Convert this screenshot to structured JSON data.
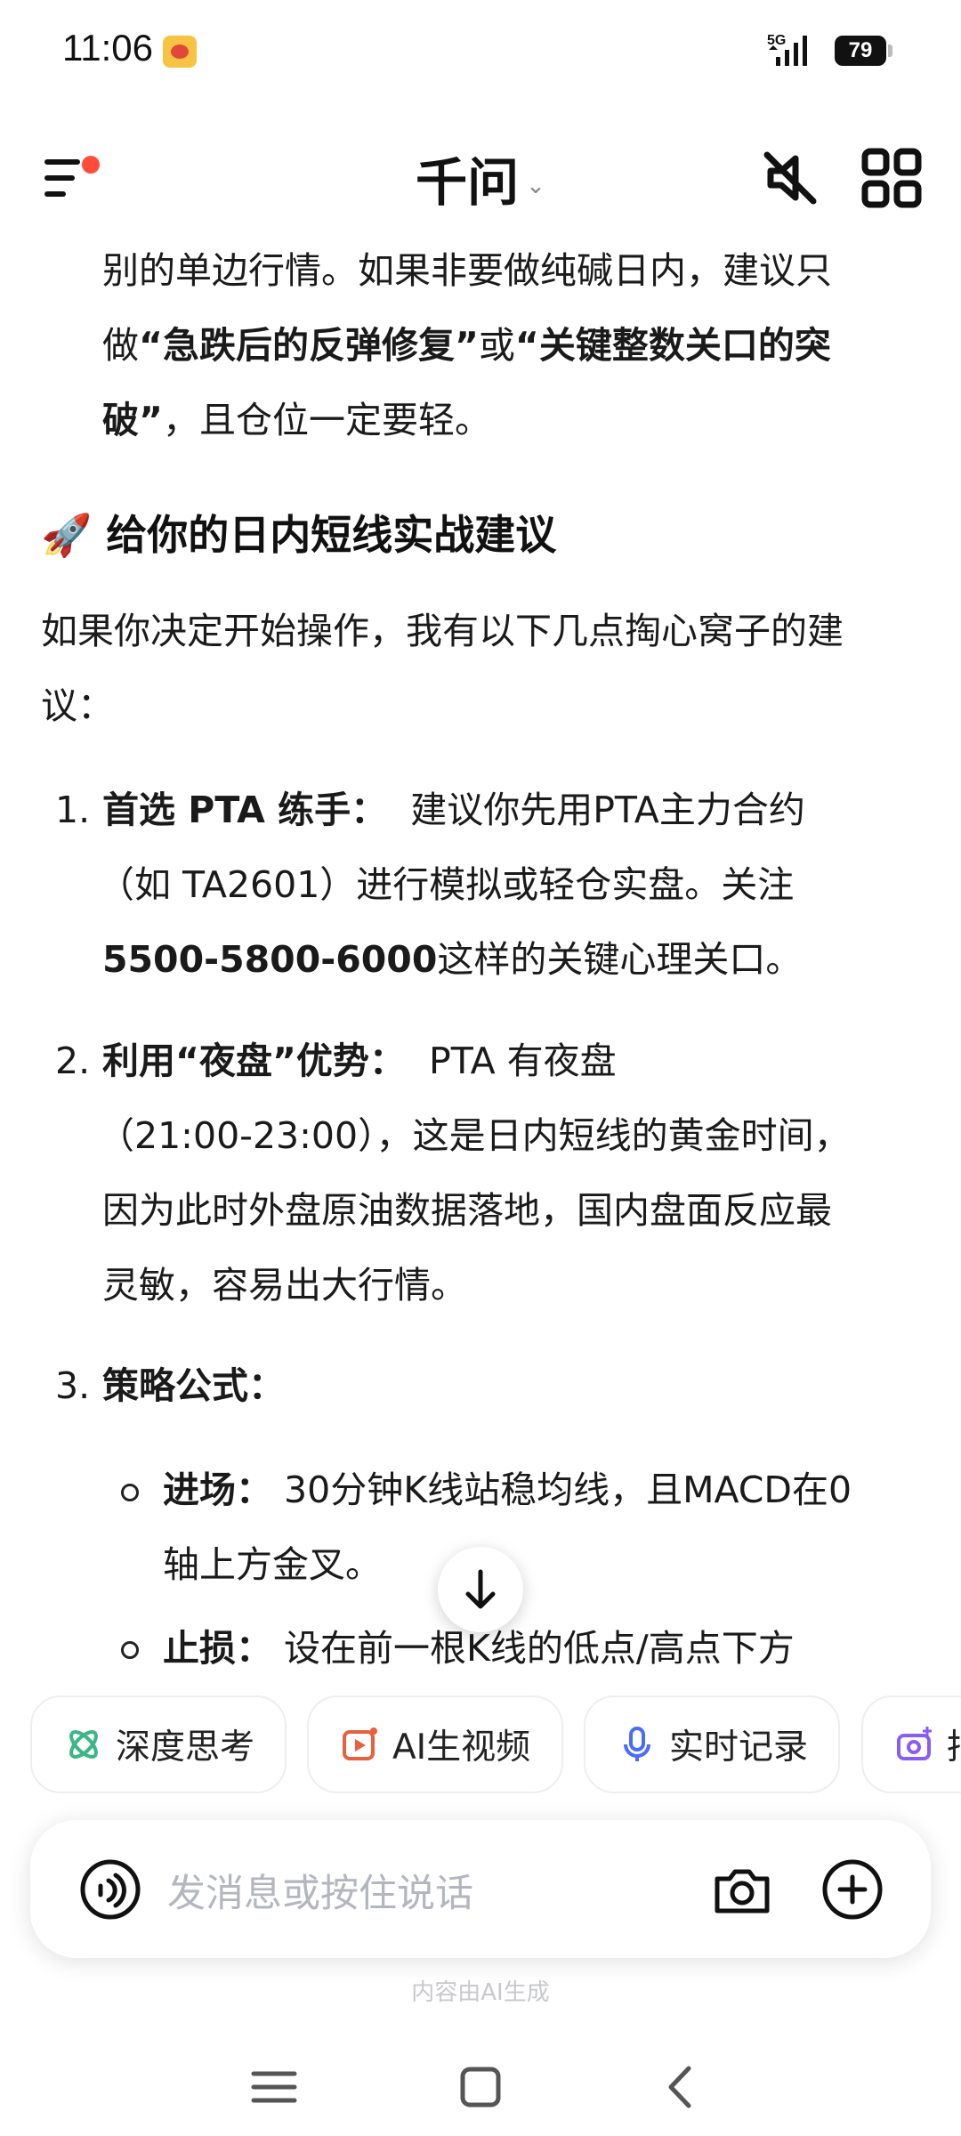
{
  "status_bar": {
    "time": "11:06",
    "network": "5G",
    "battery": "79"
  },
  "header": {
    "title": "千问"
  },
  "content": {
    "para1": {
      "line1": "别的单边行情。如果非要做纯碱日内，建议只",
      "line2_a": "做",
      "line2_b": "“急跌后的反弹修复”",
      "line2_c": "或",
      "line2_d": "“关键整数关口的突",
      "line3_a": "破”",
      "line3_b": "，且仓位一定要轻。"
    },
    "section": {
      "emoji": "🚀",
      "heading": "给你的日内短线实战建议"
    },
    "intro": {
      "line1": "如果你决定开始操作，我有以下几点掏心窝子的建",
      "line2": "议："
    },
    "item1": {
      "number": "1.",
      "title": "首选 PTA 练手：",
      "line1": "建议你先用PTA主力合约",
      "line2": "（如 TA2601）进行模拟或轻仓实盘。关注",
      "line3_bold": "5500-5800-6000",
      "line3_rest": "这样的关键心理关口。"
    },
    "item2": {
      "number": "2.",
      "title": "利用“夜盘”优势：",
      "line1": "PTA 有夜盘",
      "line2": "（21:00-23:00），这是日内短线的黄金时间，",
      "line3": "因为此时外盘原油数据落地，国内盘面反应最",
      "line4": "灵敏，容易出大行情。"
    },
    "item3": {
      "number": "3.",
      "title": "策略公式：",
      "sub1_title": "进场：",
      "sub1_line1": "30分钟K线站稳均线，且MACD在0",
      "sub1_line2": "轴上方金叉。",
      "sub2_title": "止损：",
      "sub2_line1": "设在前一根K线的低点/高点下方"
    }
  },
  "chips": [
    {
      "label": "深度思考",
      "icon": "deep-think-icon",
      "color": "#3bb58a"
    },
    {
      "label": "AI生视频",
      "icon": "ai-video-icon",
      "color": "#e8603c"
    },
    {
      "label": "实时记录",
      "icon": "microphone-icon",
      "color": "#4a6cf7"
    },
    {
      "label": "拍",
      "icon": "camera-plus-icon",
      "color": "#8a5cf6"
    }
  ],
  "input": {
    "placeholder": "发消息或按住说话"
  },
  "disclaimer": "内容由AI生成"
}
